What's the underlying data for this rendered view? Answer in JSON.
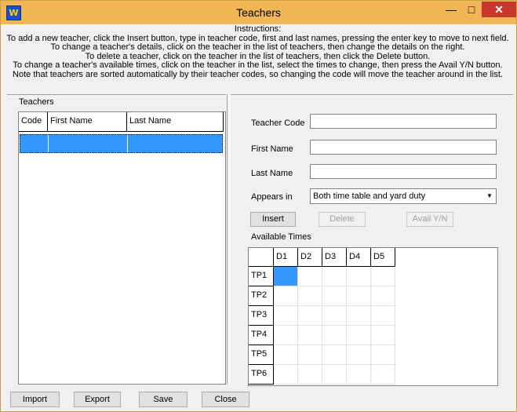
{
  "window": {
    "title": "Teachers",
    "app_icon": "W",
    "controls": {
      "minimize": "—",
      "maximize": "□",
      "close": "✕"
    }
  },
  "instructions": {
    "heading": "Instructions:",
    "lines": [
      "To add a new teacher, click the Insert button, type in teacher code, first and last names, pressing the enter key to move to next field.",
      "To change a teacher's details, click on the teacher in the list of teachers, then change the details on the right.",
      "To delete a teacher, click on the teacher in the list of teachers, then click the Delete button.",
      "To change a teacher's available times, click on the teacher in the list, select the times to change, then press the Avail Y/N button.",
      "Note that teachers are sorted automatically by their teacher codes, so changing the code will move the teacher around in the list."
    ]
  },
  "teachers_list": {
    "label": "Teachers",
    "columns": [
      "Code",
      "First Name",
      "Last Name"
    ]
  },
  "form": {
    "teacher_code_label": "Teacher Code",
    "teacher_code_value": "",
    "first_name_label": "First Name",
    "first_name_value": "",
    "last_name_label": "Last Name",
    "last_name_value": "",
    "appears_in_label": "Appears in",
    "appears_in_value": "Both time table and yard duty"
  },
  "buttons": {
    "insert": "Insert",
    "delete": "Delete",
    "avail": "Avail Y/N",
    "import": "Import",
    "export": "Export",
    "save": "Save",
    "close": "Close"
  },
  "available_times": {
    "label": "Available Times",
    "days": [
      "D1",
      "D2",
      "D3",
      "D4",
      "D5"
    ],
    "periods": [
      "TP1",
      "TP2",
      "TP3",
      "TP4",
      "TP5",
      "TP6"
    ]
  },
  "colors": {
    "titlebar": "#f0b554",
    "selection": "#3399ff",
    "close_button": "#c7372f"
  }
}
